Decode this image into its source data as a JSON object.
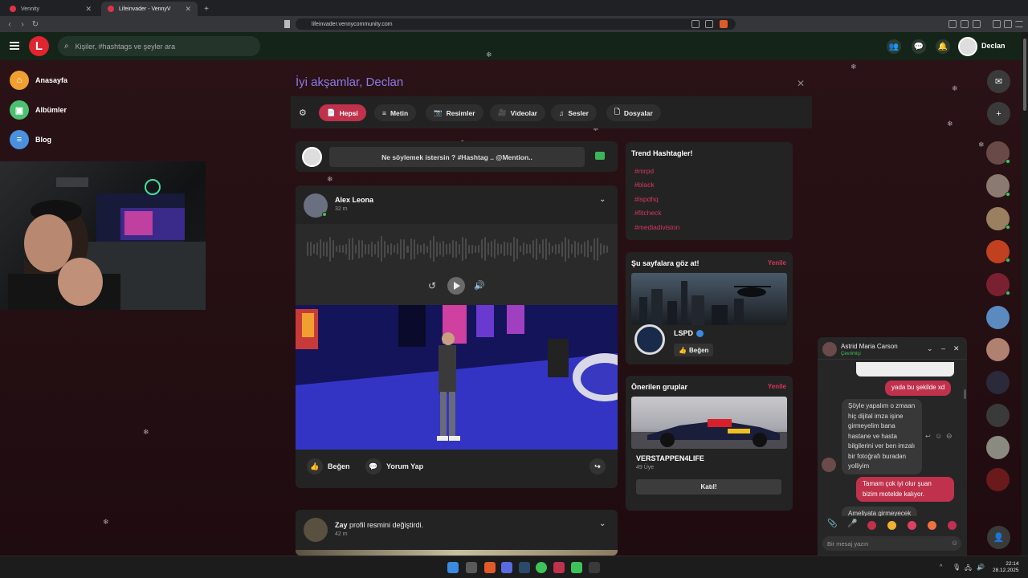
{
  "browser": {
    "tabs": [
      {
        "label": "Vennity",
        "active": false
      },
      {
        "label": "Lifeinvader - VennyV",
        "active": true
      }
    ],
    "new_tab": "+",
    "url": "lifeinvader.vennycommunity.com"
  },
  "header": {
    "logo": "L",
    "search_placeholder": "Kişiler, #hashtags ve şeyler ara",
    "user_name": "Declan",
    "icons": [
      "people-icon",
      "chat-icon",
      "bell-icon"
    ]
  },
  "sidebar": {
    "items": [
      {
        "label": "Anasayfa",
        "icon": "home-icon",
        "color": "#f0a030"
      },
      {
        "label": "Albümler",
        "icon": "image-icon",
        "color": "#4cc070"
      },
      {
        "label": "Blog",
        "icon": "document-icon",
        "color": "#4a90e0"
      }
    ]
  },
  "greeting": {
    "text": "İyi akşamlar, Declan",
    "close": "✕"
  },
  "filters": [
    {
      "label": "Hepsi",
      "icon": "📄",
      "active": true
    },
    {
      "label": "Metin",
      "icon": "≡",
      "active": false
    },
    {
      "label": "Resimler",
      "icon": "📷",
      "active": false
    },
    {
      "label": "Videolar",
      "icon": "🎥",
      "active": false
    },
    {
      "label": "Sesler",
      "icon": "♫",
      "active": false
    },
    {
      "label": "Dosyalar",
      "icon": "🗋",
      "active": false
    }
  ],
  "composer": {
    "placeholder": "Ne söylemek istersin ? #Hashtag .. @Mention.."
  },
  "posts": [
    {
      "author": "Alex Leona",
      "time": "32 m",
      "like_label": "Beğen",
      "comment_label": "Yorum Yap"
    },
    {
      "author": "Zay",
      "action": "profil resmini değiştirdi.",
      "time": "42 m"
    }
  ],
  "trends": {
    "title": "Trend Hashtagler!",
    "tags": [
      "#mrpd",
      "#black",
      "#lspdhq",
      "#fitcheck",
      "#mediadivision"
    ]
  },
  "suggested_pages": {
    "title": "Şu sayfalara göz at!",
    "renew": "Yenile",
    "page_name": "LSPD",
    "like_label": "Beğen"
  },
  "suggested_groups": {
    "title": "Önerilen gruplar",
    "renew": "Yenile",
    "group_name": "VERSTAPPEN4LIFE",
    "members": "49 Üye",
    "join_label": "Katıl!"
  },
  "chat": {
    "name": "Astrid Maria Carson",
    "status": "Çevrimiçi",
    "messages": [
      {
        "from": "me",
        "text": "yada bu şekilde xd"
      },
      {
        "from": "them",
        "text": "Şöyle yapalım o zmaan hiç dijital imza işine girmeyelim bana hastane ve hasta bilgilerini ver ben imzalı bir fotoğrafı buradan yolliyim"
      },
      {
        "from": "me",
        "text": "Tamam çok iyi olur şuan bizim motelde kalıyor."
      },
      {
        "from": "them",
        "text": "Ameliyata girmeyecek"
      }
    ],
    "input_placeholder": "Bir mesaj yazın"
  },
  "taskbar": {
    "time": "22:14",
    "date": "28.12.2025"
  },
  "colors": {
    "accent": "#c0314c",
    "greeting": "#8e79e8",
    "hashtag": "#d8365a",
    "online": "#3cc45a"
  }
}
